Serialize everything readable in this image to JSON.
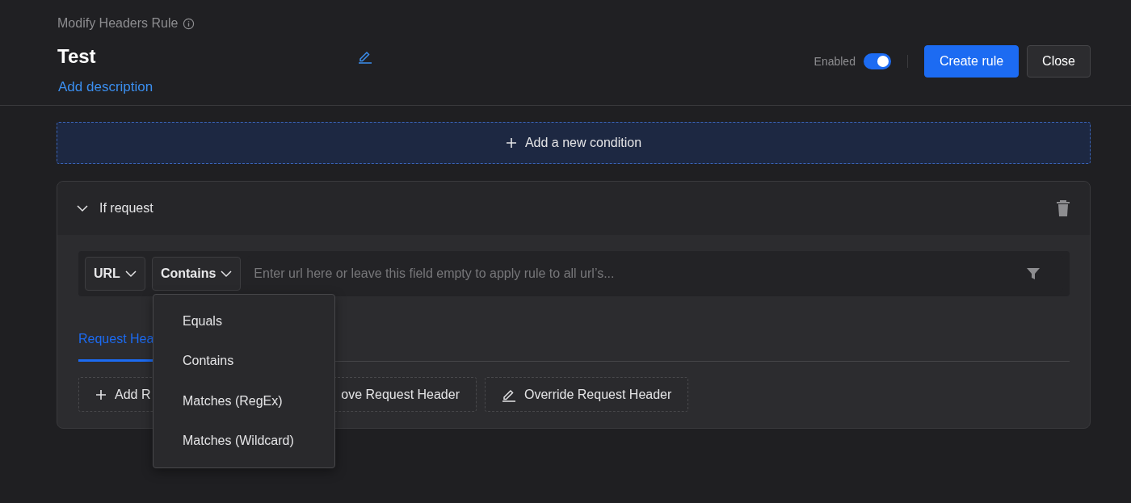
{
  "header": {
    "rule_type": "Modify Headers Rule",
    "name": "Test",
    "description_link": "Add description",
    "enabled_label": "Enabled",
    "enabled": true,
    "create_button": "Create rule",
    "close_button": "Close"
  },
  "add_condition": "Add a new condition",
  "condition": {
    "title": "If request",
    "expanded": true,
    "source": "URL",
    "operator": "Contains",
    "url_placeholder": "Enter url here or leave this field empty to apply rule to all url’s...",
    "operator_menu": {
      "open": true,
      "options": [
        "Equals",
        "Contains",
        "Matches (RegEx)",
        "Matches (Wildcard)"
      ]
    },
    "tabs": [
      {
        "label": "Request Hea",
        "selected": true
      }
    ],
    "actions": [
      {
        "kind": "add",
        "label": "Add R"
      },
      {
        "kind": "remove",
        "label": "ove Request Header"
      },
      {
        "kind": "override",
        "label": "Override Request Header"
      }
    ]
  }
}
